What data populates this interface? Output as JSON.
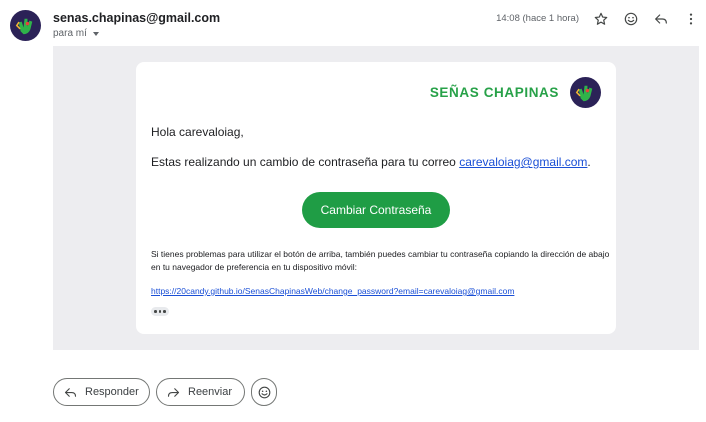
{
  "header": {
    "sender_email": "senas.chapinas@gmail.com",
    "recipient_label": "para mí",
    "timestamp": "14:08 (hace 1 hora)",
    "icons": [
      "star-icon",
      "emoji-icon",
      "reply-icon",
      "more-vert-icon"
    ]
  },
  "email": {
    "brand_name": "SEÑAS CHAPINAS",
    "greeting": "Hola carevaloiag,",
    "message_prefix": "Estas realizando un cambio de contraseña para tu correo ",
    "message_email_link": "carevaloiag@gmail.com",
    "message_suffix": ".",
    "cta_label": "Cambiar Contraseña",
    "help_text": "Si tienes problemas para utilizar el botón de arriba, también puedes cambiar tu contraseña copiando la dirección de abajo en tu navegador de preferencia en tu dispositivo móvil:",
    "reset_url": "https://20candy.github.io/SenasChapinasWeb/change_password?email=carevaloiag@gmail.com"
  },
  "actions": {
    "reply_label": "Responder",
    "forward_label": "Reenviar"
  },
  "colors": {
    "brand_green": "#27a148",
    "cta_green": "#1f9d45",
    "logo_bg": "#2b2257",
    "link_blue": "#1a4fd6",
    "body_bg": "#ededf0"
  }
}
